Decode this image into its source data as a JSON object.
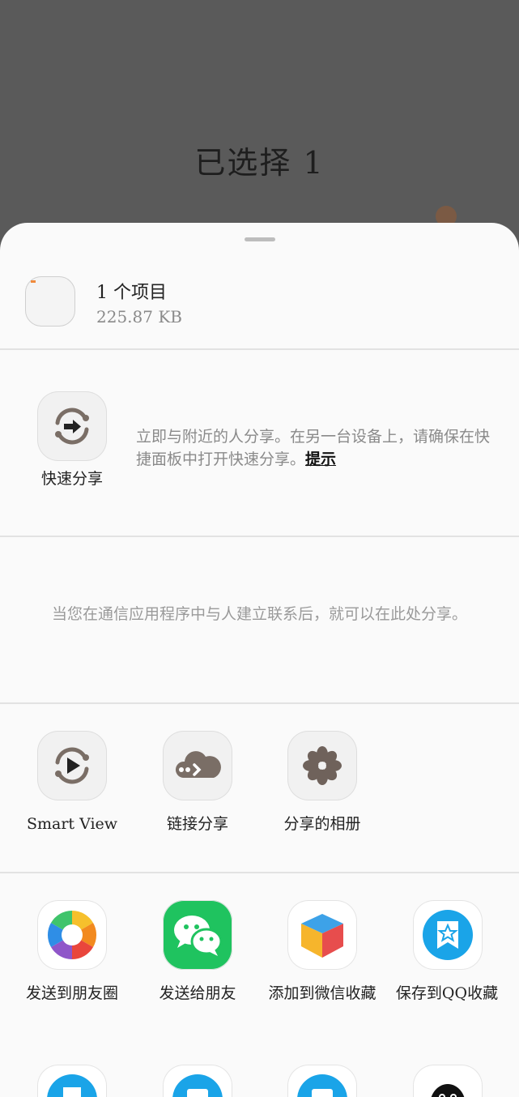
{
  "backdrop": {
    "title": "已选择 1"
  },
  "file": {
    "count_label": "1 个项目",
    "size": "225.87 KB"
  },
  "quick_share": {
    "label": "快速分享",
    "desc": "立即与附近的人分享。在另一台设备上，请确保在快捷面板中打开快速分享。",
    "tip": "提示"
  },
  "contacts": {
    "empty_message": "当您在通信应用程序中与人建立联系后，就可以在此处分享。"
  },
  "system_shares": [
    {
      "label": "Smart View",
      "icon": "smart-view-icon"
    },
    {
      "label": "链接分享",
      "icon": "cloud-link-icon"
    },
    {
      "label": "分享的相册",
      "icon": "flower-album-icon"
    }
  ],
  "apps": [
    {
      "label": "发送到朋友圈",
      "icon": "moments-aperture-icon"
    },
    {
      "label": "发送给朋友",
      "icon": "wechat-icon"
    },
    {
      "label": "添加到微信收藏",
      "icon": "wechat-favorites-cube-icon"
    },
    {
      "label": "保存到QQ收藏",
      "icon": "qq-favorites-icon"
    }
  ],
  "colors": {
    "accent_gray": "#7a6e66",
    "wechat_green": "#1fc35f",
    "qq_blue": "#1aa4e8"
  }
}
